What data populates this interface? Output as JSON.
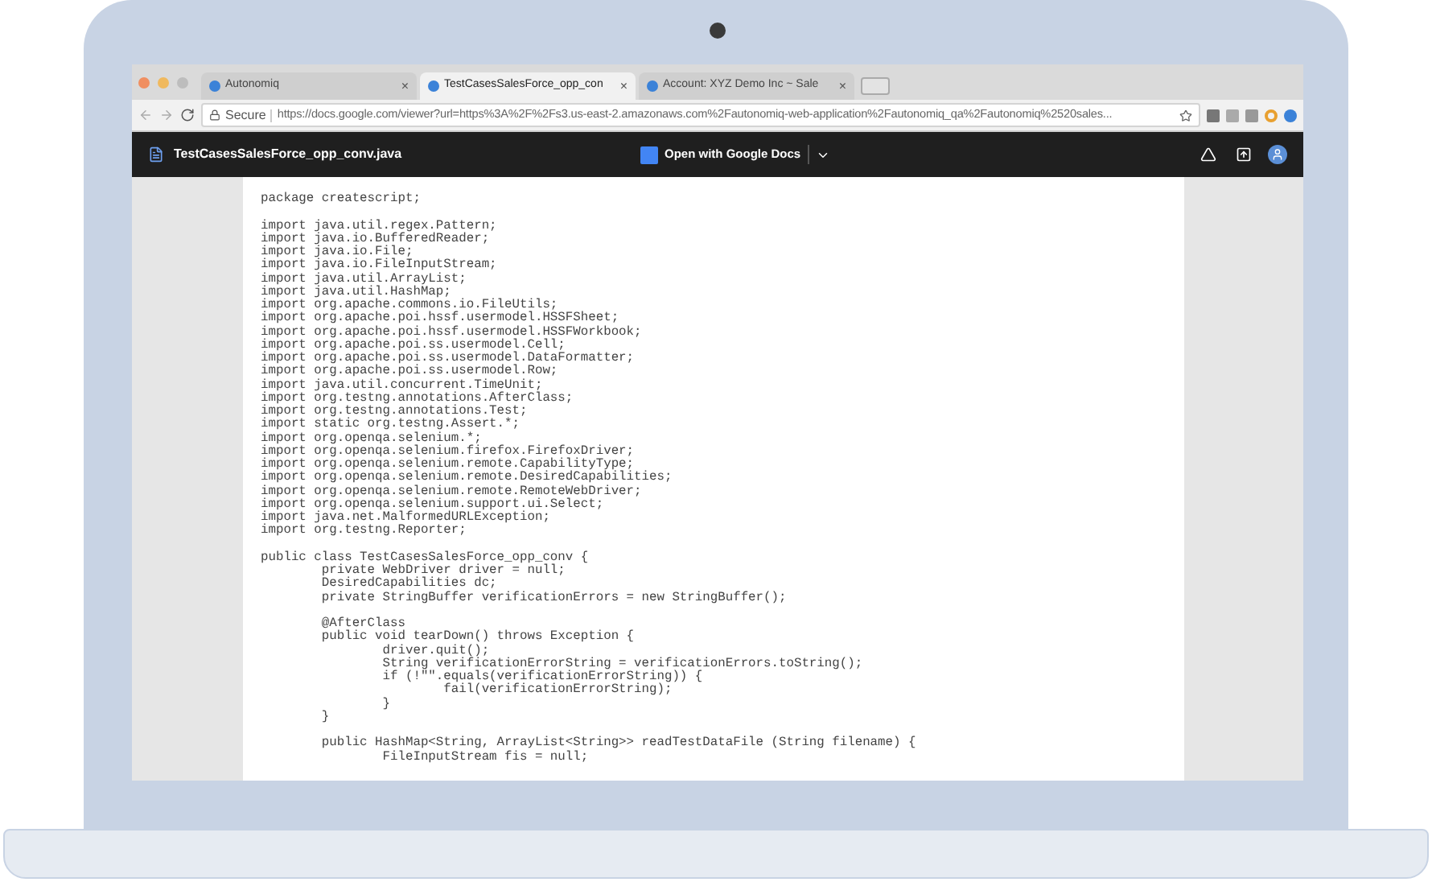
{
  "browser": {
    "tabs": [
      {
        "title": "Autonomiq",
        "close": "×",
        "selected": false
      },
      {
        "title": "TestCasesSalesForce_opp_con",
        "close": "×",
        "selected": true
      },
      {
        "title": "Account: XYZ Demo Inc ~ Sale",
        "close": "×",
        "selected": false
      }
    ],
    "secure_label": "Secure",
    "url": "https://docs.google.com/viewer?url=https%3A%2F%2Fs3.us-east-2.amazonaws.com%2Fautonomiq-web-application%2Fautonomiq_qa%2Fautonomiq%2520sales..."
  },
  "viewer": {
    "file_name": "TestCasesSalesForce_opp_conv.java",
    "open_button": "Open with Google Docs",
    "code": "package createscript;\n\nimport java.util.regex.Pattern;\nimport java.io.BufferedReader;\nimport java.io.File;\nimport java.io.FileInputStream;\nimport java.util.ArrayList;\nimport java.util.HashMap;\nimport org.apache.commons.io.FileUtils;\nimport org.apache.poi.hssf.usermodel.HSSFSheet;\nimport org.apache.poi.hssf.usermodel.HSSFWorkbook;\nimport org.apache.poi.ss.usermodel.Cell;\nimport org.apache.poi.ss.usermodel.DataFormatter;\nimport org.apache.poi.ss.usermodel.Row;\nimport java.util.concurrent.TimeUnit;\nimport org.testng.annotations.AfterClass;\nimport org.testng.annotations.Test;\nimport static org.testng.Assert.*;\nimport org.openqa.selenium.*;\nimport org.openqa.selenium.firefox.FirefoxDriver;\nimport org.openqa.selenium.remote.CapabilityType;\nimport org.openqa.selenium.remote.DesiredCapabilities;\nimport org.openqa.selenium.remote.RemoteWebDriver;\nimport org.openqa.selenium.support.ui.Select;\nimport java.net.MalformedURLException;\nimport org.testng.Reporter;\n\npublic class TestCasesSalesForce_opp_conv {\n        private WebDriver driver = null;\n        DesiredCapabilities dc;\n        private StringBuffer verificationErrors = new StringBuffer();\n\n        @AfterClass\n        public void tearDown() throws Exception {\n                driver.quit();\n                String verificationErrorString = verificationErrors.toString();\n                if (!\"\".equals(verificationErrorString)) {\n                        fail(verificationErrorString);\n                }\n        }\n\n        public HashMap<String, ArrayList<String>> readTestDataFile (String filename) {\n                FileInputStream fis = null;"
  }
}
